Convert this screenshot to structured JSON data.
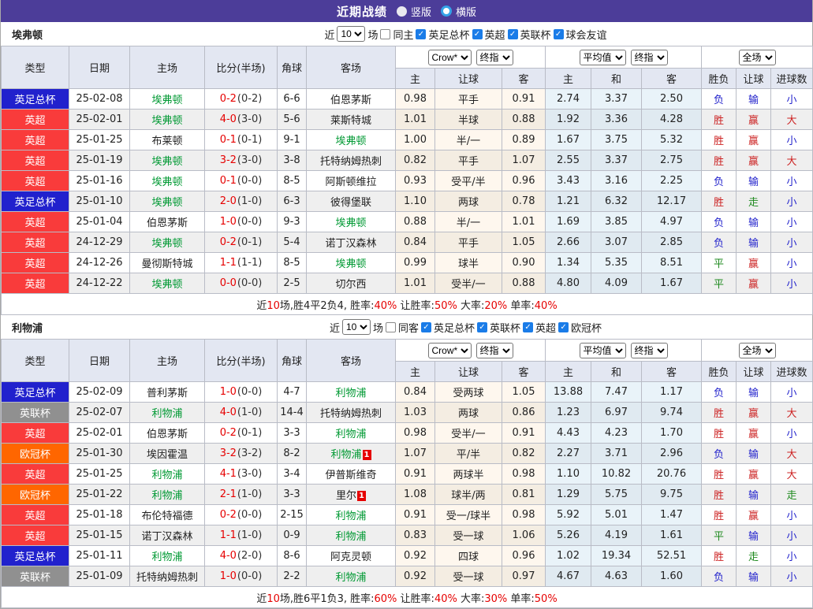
{
  "titlebar": {
    "title": "近期战绩",
    "radios": [
      {
        "label": "竖版",
        "selected": true
      },
      {
        "label": "横版",
        "selected": false
      }
    ]
  },
  "columns": {
    "type": "类型",
    "date": "日期",
    "home": "主场",
    "score": "比分(半场)",
    "corner": "角球",
    "away": "客场",
    "odds_home": "主",
    "odds_handicap": "让球",
    "odds_away": "客",
    "avg_home": "主",
    "avg_draw": "和",
    "avg_away": "客",
    "wl": "胜负",
    "handicap_result": "让球",
    "goals": "进球数"
  },
  "dropdowns": {
    "bookmaker": "Crow*",
    "final1": "终指",
    "average": "平均值",
    "final2": "终指",
    "scope": "全场"
  },
  "colors": {
    "accent_purple": "#4c3d99",
    "league_blue": "#2121cd",
    "league_red": "#f93b3b",
    "league_gray": "#909090",
    "league_orange": "#ff6600",
    "team_green": "#009933",
    "score_red": "#e60000",
    "win_red": "#cc2222",
    "lose_blue": "#2323cc",
    "draw_green": "#1f8a1f",
    "checkbox_blue": "#1a7ce8"
  },
  "sections": [
    {
      "team": "埃弗顿",
      "filter": {
        "near": "近",
        "count": "10",
        "games": "场",
        "venue": "同主",
        "leagues": [
          "英足总杯",
          "英超",
          "英联杯",
          "球会友谊"
        ]
      },
      "rows": [
        {
          "lg": "英足总杯",
          "lgc": "blue",
          "date": "25-02-08",
          "home": "埃弗顿",
          "hg": true,
          "hb": "",
          "ft": "0-2",
          "ht": "(0-2)",
          "cn": "6-6",
          "away": "伯恩茅斯",
          "ag": false,
          "ab": "",
          "o1": "0.98",
          "hc": "平手",
          "o2": "0.91",
          "a1": "2.74",
          "a2": "3.37",
          "a3": "2.50",
          "r1": "负",
          "c1": "blue",
          "r2": "输",
          "c2": "blue",
          "r3": "小",
          "c3": "blue"
        },
        {
          "lg": "英超",
          "lgc": "red",
          "date": "25-02-01",
          "home": "埃弗顿",
          "hg": true,
          "hb": "",
          "ft": "4-0",
          "ht": "(3-0)",
          "cn": "5-6",
          "away": "莱斯特城",
          "ag": false,
          "ab": "",
          "o1": "1.01",
          "hc": "半球",
          "o2": "0.88",
          "a1": "1.92",
          "a2": "3.36",
          "a3": "4.28",
          "r1": "胜",
          "c1": "red",
          "r2": "赢",
          "c2": "red",
          "r3": "大",
          "c3": "red"
        },
        {
          "lg": "英超",
          "lgc": "red",
          "date": "25-01-25",
          "home": "布莱顿",
          "hg": false,
          "hb": "",
          "ft": "0-1",
          "ht": "(0-1)",
          "cn": "9-1",
          "away": "埃弗顿",
          "ag": true,
          "ab": "",
          "o1": "1.00",
          "hc": "半/一",
          "o2": "0.89",
          "a1": "1.67",
          "a2": "3.75",
          "a3": "5.32",
          "r1": "胜",
          "c1": "red",
          "r2": "赢",
          "c2": "red",
          "r3": "小",
          "c3": "blue"
        },
        {
          "lg": "英超",
          "lgc": "red",
          "date": "25-01-19",
          "home": "埃弗顿",
          "hg": true,
          "hb": "",
          "ft": "3-2",
          "ht": "(3-0)",
          "cn": "3-8",
          "away": "托特纳姆热刺",
          "ag": false,
          "ab": "",
          "o1": "0.82",
          "hc": "平手",
          "o2": "1.07",
          "a1": "2.55",
          "a2": "3.37",
          "a3": "2.75",
          "r1": "胜",
          "c1": "red",
          "r2": "赢",
          "c2": "red",
          "r3": "大",
          "c3": "red"
        },
        {
          "lg": "英超",
          "lgc": "red",
          "date": "25-01-16",
          "home": "埃弗顿",
          "hg": true,
          "hb": "",
          "ft": "0-1",
          "ht": "(0-0)",
          "cn": "8-5",
          "away": "阿斯顿维拉",
          "ag": false,
          "ab": "",
          "o1": "0.93",
          "hc": "受平/半",
          "o2": "0.96",
          "a1": "3.43",
          "a2": "3.16",
          "a3": "2.25",
          "r1": "负",
          "c1": "blue",
          "r2": "输",
          "c2": "blue",
          "r3": "小",
          "c3": "blue"
        },
        {
          "lg": "英足总杯",
          "lgc": "blue",
          "date": "25-01-10",
          "home": "埃弗顿",
          "hg": true,
          "hb": "",
          "ft": "2-0",
          "ht": "(1-0)",
          "cn": "6-3",
          "away": "彼得堡联",
          "ag": false,
          "ab": "",
          "o1": "1.10",
          "hc": "两球",
          "o2": "0.78",
          "a1": "1.21",
          "a2": "6.32",
          "a3": "12.17",
          "r1": "胜",
          "c1": "red",
          "r2": "走",
          "c2": "green",
          "r3": "小",
          "c3": "blue"
        },
        {
          "lg": "英超",
          "lgc": "red",
          "date": "25-01-04",
          "home": "伯恩茅斯",
          "hg": false,
          "hb": "",
          "ft": "1-0",
          "ht": "(0-0)",
          "cn": "9-3",
          "away": "埃弗顿",
          "ag": true,
          "ab": "",
          "o1": "0.88",
          "hc": "半/一",
          "o2": "1.01",
          "a1": "1.69",
          "a2": "3.85",
          "a3": "4.97",
          "r1": "负",
          "c1": "blue",
          "r2": "输",
          "c2": "blue",
          "r3": "小",
          "c3": "blue"
        },
        {
          "lg": "英超",
          "lgc": "red",
          "date": "24-12-29",
          "home": "埃弗顿",
          "hg": true,
          "hb": "",
          "ft": "0-2",
          "ht": "(0-1)",
          "cn": "5-4",
          "away": "诺丁汉森林",
          "ag": false,
          "ab": "",
          "o1": "0.84",
          "hc": "平手",
          "o2": "1.05",
          "a1": "2.66",
          "a2": "3.07",
          "a3": "2.85",
          "r1": "负",
          "c1": "blue",
          "r2": "输",
          "c2": "blue",
          "r3": "小",
          "c3": "blue"
        },
        {
          "lg": "英超",
          "lgc": "red",
          "date": "24-12-26",
          "home": "曼彻斯特城",
          "hg": false,
          "hb": "",
          "ft": "1-1",
          "ht": "(1-1)",
          "cn": "8-5",
          "away": "埃弗顿",
          "ag": true,
          "ab": "",
          "o1": "0.99",
          "hc": "球半",
          "o2": "0.90",
          "a1": "1.34",
          "a2": "5.35",
          "a3": "8.51",
          "r1": "平",
          "c1": "green",
          "r2": "赢",
          "c2": "red",
          "r3": "小",
          "c3": "blue"
        },
        {
          "lg": "英超",
          "lgc": "red",
          "date": "24-12-22",
          "home": "埃弗顿",
          "hg": true,
          "hb": "",
          "ft": "0-0",
          "ht": "(0-0)",
          "cn": "2-5",
          "away": "切尔西",
          "ag": false,
          "ab": "",
          "o1": "1.01",
          "hc": "受半/一",
          "o2": "0.88",
          "a1": "4.80",
          "a2": "4.09",
          "a3": "1.67",
          "r1": "平",
          "c1": "green",
          "r2": "赢",
          "c2": "red",
          "r3": "小",
          "c3": "blue"
        }
      ],
      "summary": [
        {
          "t": "近",
          "red": false
        },
        {
          "t": "10",
          "red": true
        },
        {
          "t": "场,胜4平2负4, 胜率:",
          "red": false
        },
        {
          "t": "40%",
          "red": true
        },
        {
          "t": " 让胜率:",
          "red": false
        },
        {
          "t": "50%",
          "red": true
        },
        {
          "t": " 大率:",
          "red": false
        },
        {
          "t": "20%",
          "red": true
        },
        {
          "t": " 单率:",
          "red": false
        },
        {
          "t": "40%",
          "red": true
        }
      ]
    },
    {
      "team": "利物浦",
      "filter": {
        "near": "近",
        "count": "10",
        "games": "场",
        "venue": "同客",
        "leagues": [
          "英足总杯",
          "英联杯",
          "英超",
          "欧冠杯"
        ]
      },
      "rows": [
        {
          "lg": "英足总杯",
          "lgc": "blue",
          "date": "25-02-09",
          "home": "普利茅斯",
          "hg": false,
          "hb": "",
          "ft": "1-0",
          "ht": "(0-0)",
          "cn": "4-7",
          "away": "利物浦",
          "ag": true,
          "ab": "",
          "o1": "0.84",
          "hc": "受两球",
          "o2": "1.05",
          "a1": "13.88",
          "a2": "7.47",
          "a3": "1.17",
          "r1": "负",
          "c1": "blue",
          "r2": "输",
          "c2": "blue",
          "r3": "小",
          "c3": "blue"
        },
        {
          "lg": "英联杯",
          "lgc": "gray",
          "date": "25-02-07",
          "home": "利物浦",
          "hg": true,
          "hb": "",
          "ft": "4-0",
          "ht": "(1-0)",
          "cn": "14-4",
          "away": "托特纳姆热刺",
          "ag": false,
          "ab": "",
          "o1": "1.03",
          "hc": "两球",
          "o2": "0.86",
          "a1": "1.23",
          "a2": "6.97",
          "a3": "9.74",
          "r1": "胜",
          "c1": "red",
          "r2": "赢",
          "c2": "red",
          "r3": "大",
          "c3": "red"
        },
        {
          "lg": "英超",
          "lgc": "red",
          "date": "25-02-01",
          "home": "伯恩茅斯",
          "hg": false,
          "hb": "",
          "ft": "0-2",
          "ht": "(0-1)",
          "cn": "3-3",
          "away": "利物浦",
          "ag": true,
          "ab": "",
          "o1": "0.98",
          "hc": "受半/一",
          "o2": "0.91",
          "a1": "4.43",
          "a2": "4.23",
          "a3": "1.70",
          "r1": "胜",
          "c1": "red",
          "r2": "赢",
          "c2": "red",
          "r3": "小",
          "c3": "blue"
        },
        {
          "lg": "欧冠杯",
          "lgc": "orange",
          "date": "25-01-30",
          "home": "埃因霍温",
          "hg": false,
          "hb": "",
          "ft": "3-2",
          "ht": "(3-2)",
          "cn": "8-2",
          "away": "利物浦",
          "ag": true,
          "ab": "1",
          "o1": "1.07",
          "hc": "平/半",
          "o2": "0.82",
          "a1": "2.27",
          "a2": "3.71",
          "a3": "2.96",
          "r1": "负",
          "c1": "blue",
          "r2": "输",
          "c2": "blue",
          "r3": "大",
          "c3": "red"
        },
        {
          "lg": "英超",
          "lgc": "red",
          "date": "25-01-25",
          "home": "利物浦",
          "hg": true,
          "hb": "",
          "ft": "4-1",
          "ht": "(3-0)",
          "cn": "3-4",
          "away": "伊普斯维奇",
          "ag": false,
          "ab": "",
          "o1": "0.91",
          "hc": "两球半",
          "o2": "0.98",
          "a1": "1.10",
          "a2": "10.82",
          "a3": "20.76",
          "r1": "胜",
          "c1": "red",
          "r2": "赢",
          "c2": "red",
          "r3": "大",
          "c3": "red"
        },
        {
          "lg": "欧冠杯",
          "lgc": "orange",
          "date": "25-01-22",
          "home": "利物浦",
          "hg": true,
          "hb": "",
          "ft": "2-1",
          "ht": "(1-0)",
          "cn": "3-3",
          "away": "里尔",
          "ag": false,
          "ab": "1",
          "o1": "1.08",
          "hc": "球半/两",
          "o2": "0.81",
          "a1": "1.29",
          "a2": "5.75",
          "a3": "9.75",
          "r1": "胜",
          "c1": "red",
          "r2": "输",
          "c2": "blue",
          "r3": "走",
          "c3": "green"
        },
        {
          "lg": "英超",
          "lgc": "red",
          "date": "25-01-18",
          "home": "布伦特福德",
          "hg": false,
          "hb": "",
          "ft": "0-2",
          "ht": "(0-0)",
          "cn": "2-15",
          "away": "利物浦",
          "ag": true,
          "ab": "",
          "o1": "0.91",
          "hc": "受一/球半",
          "o2": "0.98",
          "a1": "5.92",
          "a2": "5.01",
          "a3": "1.47",
          "r1": "胜",
          "c1": "red",
          "r2": "赢",
          "c2": "red",
          "r3": "小",
          "c3": "blue"
        },
        {
          "lg": "英超",
          "lgc": "red",
          "date": "25-01-15",
          "home": "诺丁汉森林",
          "hg": false,
          "hb": "",
          "ft": "1-1",
          "ht": "(1-0)",
          "cn": "0-9",
          "away": "利物浦",
          "ag": true,
          "ab": "",
          "o1": "0.83",
          "hc": "受一球",
          "o2": "1.06",
          "a1": "5.26",
          "a2": "4.19",
          "a3": "1.61",
          "r1": "平",
          "c1": "green",
          "r2": "输",
          "c2": "blue",
          "r3": "小",
          "c3": "blue"
        },
        {
          "lg": "英足总杯",
          "lgc": "blue",
          "date": "25-01-11",
          "home": "利物浦",
          "hg": true,
          "hb": "",
          "ft": "4-0",
          "ht": "(2-0)",
          "cn": "8-6",
          "away": "阿克灵顿",
          "ag": false,
          "ab": "",
          "o1": "0.92",
          "hc": "四球",
          "o2": "0.96",
          "a1": "1.02",
          "a2": "19.34",
          "a3": "52.51",
          "r1": "胜",
          "c1": "red",
          "r2": "走",
          "c2": "green",
          "r3": "小",
          "c3": "blue"
        },
        {
          "lg": "英联杯",
          "lgc": "gray",
          "date": "25-01-09",
          "home": "托特纳姆热刺",
          "hg": false,
          "hb": "",
          "ft": "1-0",
          "ht": "(0-0)",
          "cn": "2-2",
          "away": "利物浦",
          "ag": true,
          "ab": "",
          "o1": "0.92",
          "hc": "受一球",
          "o2": "0.97",
          "a1": "4.67",
          "a2": "4.63",
          "a3": "1.60",
          "r1": "负",
          "c1": "blue",
          "r2": "输",
          "c2": "blue",
          "r3": "小",
          "c3": "blue"
        }
      ],
      "summary": [
        {
          "t": "近",
          "red": false
        },
        {
          "t": "10",
          "red": true
        },
        {
          "t": "场,胜6平1负3, 胜率:",
          "red": false
        },
        {
          "t": "60%",
          "red": true
        },
        {
          "t": " 让胜率:",
          "red": false
        },
        {
          "t": "40%",
          "red": true
        },
        {
          "t": " 大率:",
          "red": false
        },
        {
          "t": "30%",
          "red": true
        },
        {
          "t": " 单率:",
          "red": false
        },
        {
          "t": "50%",
          "red": true
        }
      ]
    }
  ]
}
